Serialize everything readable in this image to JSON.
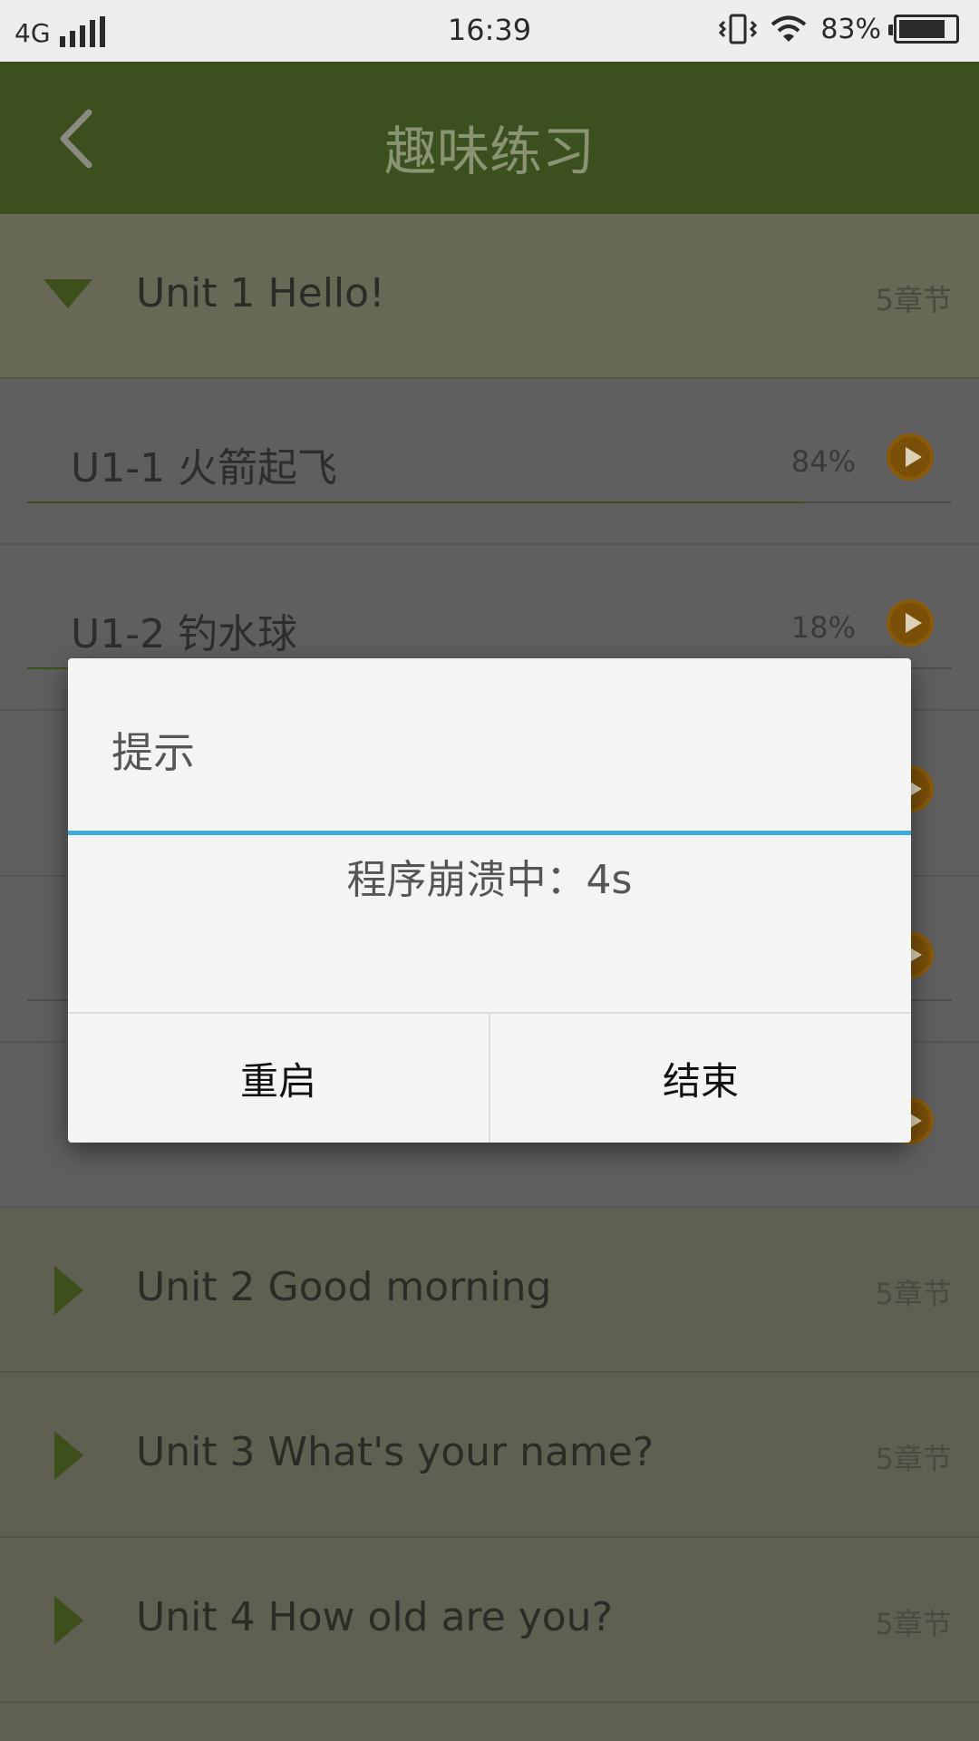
{
  "status_bar": {
    "network": "4G",
    "time": "16:39",
    "battery_percent": "83%",
    "battery_level": 0.83,
    "icons": [
      "signal-icon",
      "vibrate-icon",
      "wifi-icon",
      "battery-icon"
    ]
  },
  "app_bar": {
    "title": "趣味练习",
    "back_icon": "chevron-left-icon"
  },
  "units": [
    {
      "title": "Unit 1 Hello!",
      "count": "5章节",
      "expanded": true,
      "lessons": [
        {
          "title": "U1-1 火箭起飞",
          "percent": "84%",
          "progress": 0.84
        },
        {
          "title": "U1-2 钓水球",
          "percent": "18%",
          "progress": 0.18
        },
        {
          "title": "",
          "percent": "",
          "progress": 0
        },
        {
          "title": "",
          "percent": "",
          "progress": 0
        },
        {
          "title": "",
          "percent": "",
          "progress": 0
        }
      ]
    },
    {
      "title": "Unit 2 Good morning",
      "count": "5章节",
      "expanded": false
    },
    {
      "title": "Unit 3 What's your name?",
      "count": "5章节",
      "expanded": false
    },
    {
      "title": "Unit 4 How old are you?",
      "count": "5章节",
      "expanded": false
    }
  ],
  "dialog": {
    "title": "提示",
    "message": "程序崩溃中：4s",
    "restart_label": "重启",
    "end_label": "结束"
  },
  "colors": {
    "app_bar": "#3c4f1e",
    "accent_divider": "#3fa9dc",
    "play_button": "#7a4f08"
  }
}
